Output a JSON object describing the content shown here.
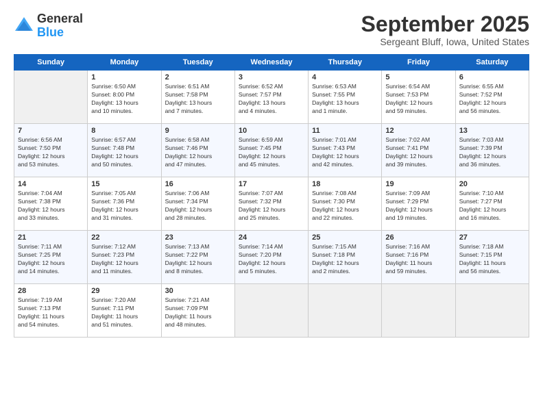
{
  "header": {
    "logo_general": "General",
    "logo_blue": "Blue",
    "month": "September 2025",
    "location": "Sergeant Bluff, Iowa, United States"
  },
  "weekdays": [
    "Sunday",
    "Monday",
    "Tuesday",
    "Wednesday",
    "Thursday",
    "Friday",
    "Saturday"
  ],
  "weeks": [
    [
      {
        "day": "",
        "info": ""
      },
      {
        "day": "1",
        "info": "Sunrise: 6:50 AM\nSunset: 8:00 PM\nDaylight: 13 hours\nand 10 minutes."
      },
      {
        "day": "2",
        "info": "Sunrise: 6:51 AM\nSunset: 7:58 PM\nDaylight: 13 hours\nand 7 minutes."
      },
      {
        "day": "3",
        "info": "Sunrise: 6:52 AM\nSunset: 7:57 PM\nDaylight: 13 hours\nand 4 minutes."
      },
      {
        "day": "4",
        "info": "Sunrise: 6:53 AM\nSunset: 7:55 PM\nDaylight: 13 hours\nand 1 minute."
      },
      {
        "day": "5",
        "info": "Sunrise: 6:54 AM\nSunset: 7:53 PM\nDaylight: 12 hours\nand 59 minutes."
      },
      {
        "day": "6",
        "info": "Sunrise: 6:55 AM\nSunset: 7:52 PM\nDaylight: 12 hours\nand 56 minutes."
      }
    ],
    [
      {
        "day": "7",
        "info": "Sunrise: 6:56 AM\nSunset: 7:50 PM\nDaylight: 12 hours\nand 53 minutes."
      },
      {
        "day": "8",
        "info": "Sunrise: 6:57 AM\nSunset: 7:48 PM\nDaylight: 12 hours\nand 50 minutes."
      },
      {
        "day": "9",
        "info": "Sunrise: 6:58 AM\nSunset: 7:46 PM\nDaylight: 12 hours\nand 47 minutes."
      },
      {
        "day": "10",
        "info": "Sunrise: 6:59 AM\nSunset: 7:45 PM\nDaylight: 12 hours\nand 45 minutes."
      },
      {
        "day": "11",
        "info": "Sunrise: 7:01 AM\nSunset: 7:43 PM\nDaylight: 12 hours\nand 42 minutes."
      },
      {
        "day": "12",
        "info": "Sunrise: 7:02 AM\nSunset: 7:41 PM\nDaylight: 12 hours\nand 39 minutes."
      },
      {
        "day": "13",
        "info": "Sunrise: 7:03 AM\nSunset: 7:39 PM\nDaylight: 12 hours\nand 36 minutes."
      }
    ],
    [
      {
        "day": "14",
        "info": "Sunrise: 7:04 AM\nSunset: 7:38 PM\nDaylight: 12 hours\nand 33 minutes."
      },
      {
        "day": "15",
        "info": "Sunrise: 7:05 AM\nSunset: 7:36 PM\nDaylight: 12 hours\nand 31 minutes."
      },
      {
        "day": "16",
        "info": "Sunrise: 7:06 AM\nSunset: 7:34 PM\nDaylight: 12 hours\nand 28 minutes."
      },
      {
        "day": "17",
        "info": "Sunrise: 7:07 AM\nSunset: 7:32 PM\nDaylight: 12 hours\nand 25 minutes."
      },
      {
        "day": "18",
        "info": "Sunrise: 7:08 AM\nSunset: 7:30 PM\nDaylight: 12 hours\nand 22 minutes."
      },
      {
        "day": "19",
        "info": "Sunrise: 7:09 AM\nSunset: 7:29 PM\nDaylight: 12 hours\nand 19 minutes."
      },
      {
        "day": "20",
        "info": "Sunrise: 7:10 AM\nSunset: 7:27 PM\nDaylight: 12 hours\nand 16 minutes."
      }
    ],
    [
      {
        "day": "21",
        "info": "Sunrise: 7:11 AM\nSunset: 7:25 PM\nDaylight: 12 hours\nand 14 minutes."
      },
      {
        "day": "22",
        "info": "Sunrise: 7:12 AM\nSunset: 7:23 PM\nDaylight: 12 hours\nand 11 minutes."
      },
      {
        "day": "23",
        "info": "Sunrise: 7:13 AM\nSunset: 7:22 PM\nDaylight: 12 hours\nand 8 minutes."
      },
      {
        "day": "24",
        "info": "Sunrise: 7:14 AM\nSunset: 7:20 PM\nDaylight: 12 hours\nand 5 minutes."
      },
      {
        "day": "25",
        "info": "Sunrise: 7:15 AM\nSunset: 7:18 PM\nDaylight: 12 hours\nand 2 minutes."
      },
      {
        "day": "26",
        "info": "Sunrise: 7:16 AM\nSunset: 7:16 PM\nDaylight: 11 hours\nand 59 minutes."
      },
      {
        "day": "27",
        "info": "Sunrise: 7:18 AM\nSunset: 7:15 PM\nDaylight: 11 hours\nand 56 minutes."
      }
    ],
    [
      {
        "day": "28",
        "info": "Sunrise: 7:19 AM\nSunset: 7:13 PM\nDaylight: 11 hours\nand 54 minutes."
      },
      {
        "day": "29",
        "info": "Sunrise: 7:20 AM\nSunset: 7:11 PM\nDaylight: 11 hours\nand 51 minutes."
      },
      {
        "day": "30",
        "info": "Sunrise: 7:21 AM\nSunset: 7:09 PM\nDaylight: 11 hours\nand 48 minutes."
      },
      {
        "day": "",
        "info": ""
      },
      {
        "day": "",
        "info": ""
      },
      {
        "day": "",
        "info": ""
      },
      {
        "day": "",
        "info": ""
      }
    ]
  ]
}
